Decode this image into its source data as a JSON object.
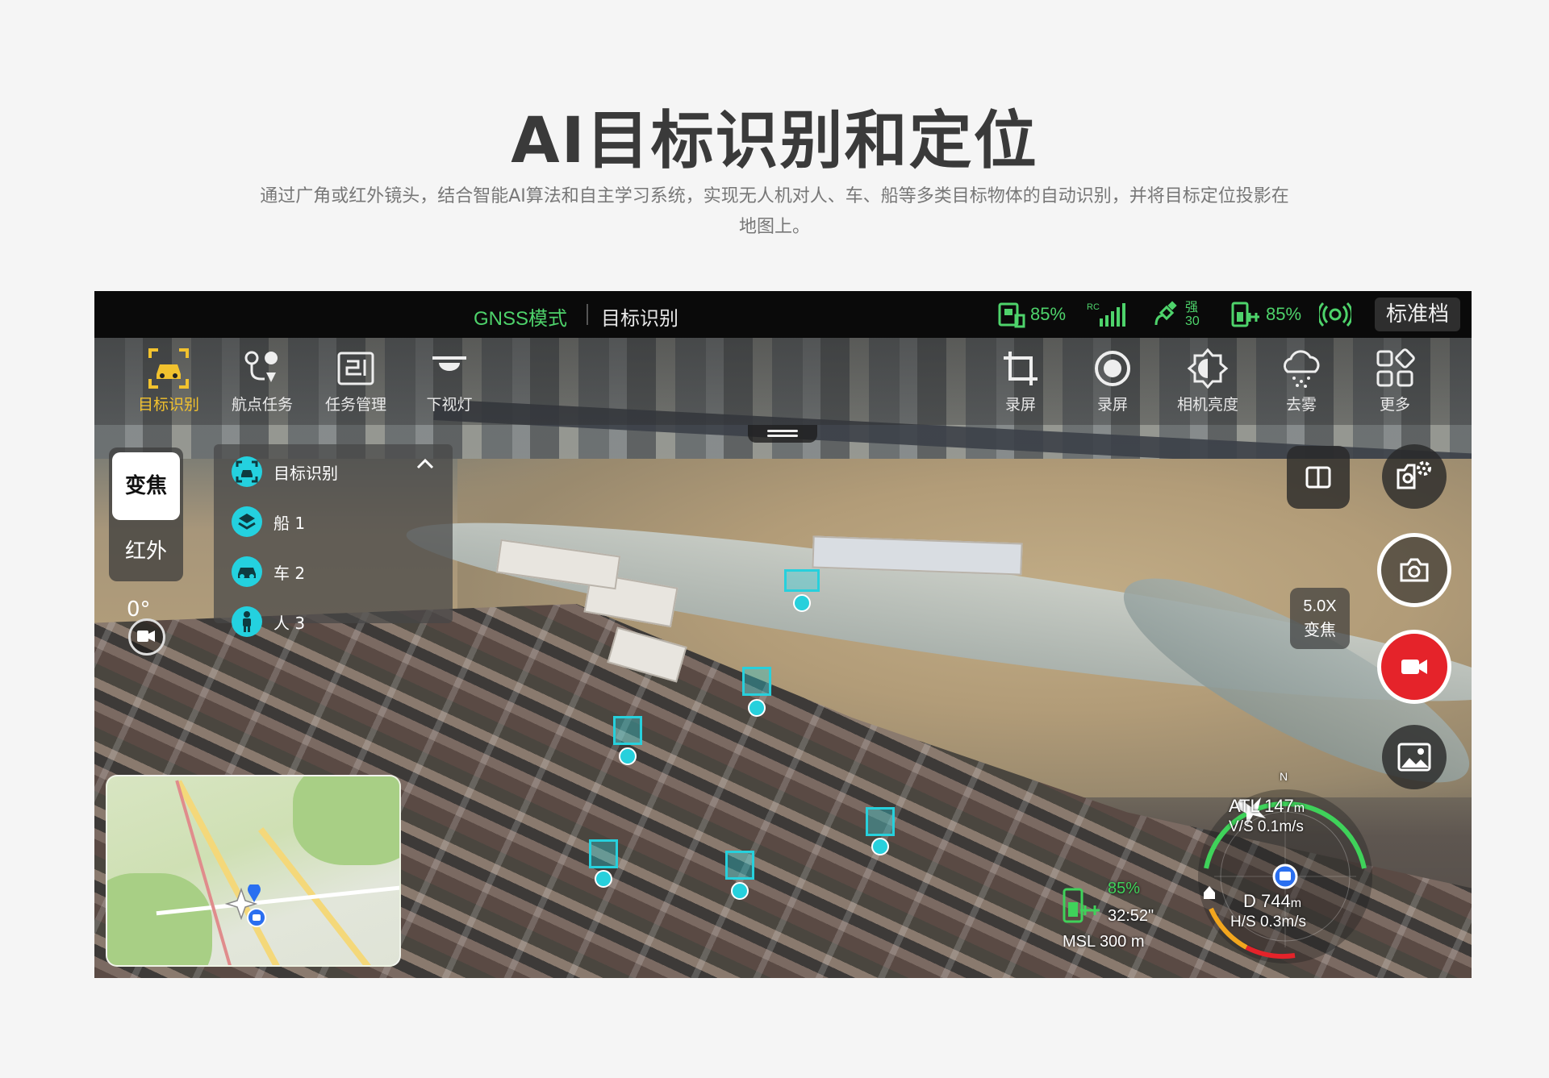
{
  "header": {
    "title": "AI目标识别和定位",
    "description_line1": "通过广角或红外镜头，结合智能AI算法和自主学习系统，实现无人机对人、车、船等多类目标物体的自动识别，并将目标定位投影在",
    "description_line2": "地图上。"
  },
  "status_bar": {
    "mode": "GNSS模式",
    "page": "目标识别",
    "rc_battery": "85%",
    "rc_label": "RC",
    "gps_strength": "强",
    "gps_count": "30",
    "drone_battery": "85%",
    "profile": "标准档"
  },
  "toolbar": {
    "left": [
      {
        "label": "目标识别",
        "icon": "car-target-icon",
        "active": true
      },
      {
        "label": "航点任务",
        "icon": "waypoint-icon",
        "active": false
      },
      {
        "label": "任务管理",
        "icon": "task-manage-icon",
        "active": false
      },
      {
        "label": "下视灯",
        "icon": "bottom-light-icon",
        "active": false
      }
    ],
    "right": [
      {
        "label": "录屏",
        "icon": "crop-icon"
      },
      {
        "label": "录屏",
        "icon": "record-screen-icon"
      },
      {
        "label": "相机亮度",
        "icon": "brightness-icon"
      },
      {
        "label": "去雾",
        "icon": "defog-icon"
      },
      {
        "label": "更多",
        "icon": "more-apps-icon"
      }
    ]
  },
  "camera": {
    "zoom_label": "变焦",
    "ir_label": "红外",
    "gimbal_angle": "0°",
    "zoom_value": "5.0X",
    "zoom_caption": "变焦"
  },
  "target_panel": {
    "title": "目标识别",
    "items": [
      {
        "label": "船 1",
        "icon": "boat-icon"
      },
      {
        "label": "车 2",
        "icon": "car-icon"
      },
      {
        "label": "人 3",
        "icon": "person-icon"
      }
    ]
  },
  "hud": {
    "compass_n": "N",
    "atl": "ATL 147",
    "atl_unit": "m",
    "vs": "V/S 0.1m/s",
    "distance": "D 744",
    "distance_unit": "m",
    "hs": "H/S 0.3m/s",
    "battery": "85%",
    "flight_time": "32:52\"",
    "msl": "MSL 300 m"
  },
  "colors": {
    "accent_green": "#4ed36b",
    "target_cyan": "#27d0dc",
    "active_yellow": "#f2c22e",
    "record_red": "#e5232a"
  }
}
